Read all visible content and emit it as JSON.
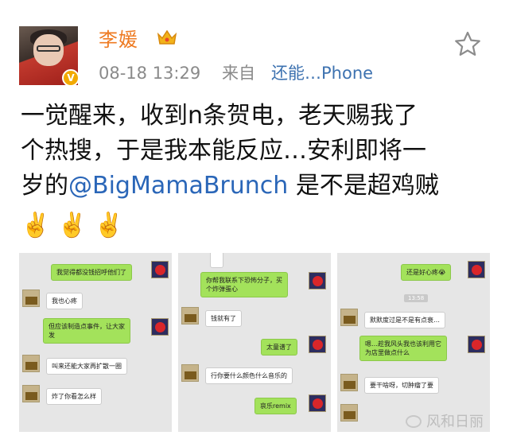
{
  "post": {
    "username": "李媛",
    "timestamp": "08-18 13:29",
    "source_prefix": "来自",
    "source": "还能…Phone",
    "content_line1": "一觉醒来，收到n条贺电，老天赐我了",
    "content_line2": "个热搜，于是我本能反应…安利即将一",
    "content_line3_a": "岁的",
    "content_mention": "@BigMamaBrunch",
    "content_line3_b": " 是不是超鸡贼",
    "emoji": [
      "✌️",
      "✌️",
      "✌️"
    ],
    "verified_badge": "V"
  },
  "colors": {
    "username": "#ee7a21",
    "mention": "#2a66b8",
    "meta": "#8a8a8a",
    "bubble_green": "#a3e25b"
  },
  "icons": {
    "crown": "crown-icon",
    "star": "star-icon",
    "verified": "verified-badge-icon"
  },
  "screenshot1": {
    "messages": [
      {
        "text": "我觉得都没钱招呼他们了",
        "side": "right"
      },
      {
        "text": "我也心疼",
        "side": "left"
      },
      {
        "text": "但应该制造点事件，让大家",
        "text2": "发",
        "side": "right"
      },
      {
        "text": "叫来还能大家再扩散一圈",
        "side": "left"
      },
      {
        "text": "炸了你看怎么样",
        "side": "left"
      }
    ]
  },
  "screenshot2": {
    "messages": [
      {
        "text": "你帮我联系下恐怖分子，买",
        "text2": "个炸弹蛋心",
        "side": "right"
      },
      {
        "text": "钱就有了",
        "side": "left"
      },
      {
        "text": "太童谱了",
        "side": "right"
      },
      {
        "text": "行你要什么颜色什么音乐的",
        "side": "left"
      },
      {
        "text": "哀乐remix",
        "side": "right"
      }
    ]
  },
  "screenshot3": {
    "messages": [
      {
        "text": "还是好心疼😭",
        "side": "right"
      },
      {
        "text": "默默度过是不是有点衰…",
        "side": "left"
      },
      {
        "text": "嗯…趁我风头我也该利用它",
        "text2": "为店里做点什么",
        "side": "right"
      },
      {
        "text": "要干啥呀，切肿瘤了要",
        "side": "left"
      }
    ],
    "time_chip": "13:58"
  },
  "watermark": "风和日丽"
}
